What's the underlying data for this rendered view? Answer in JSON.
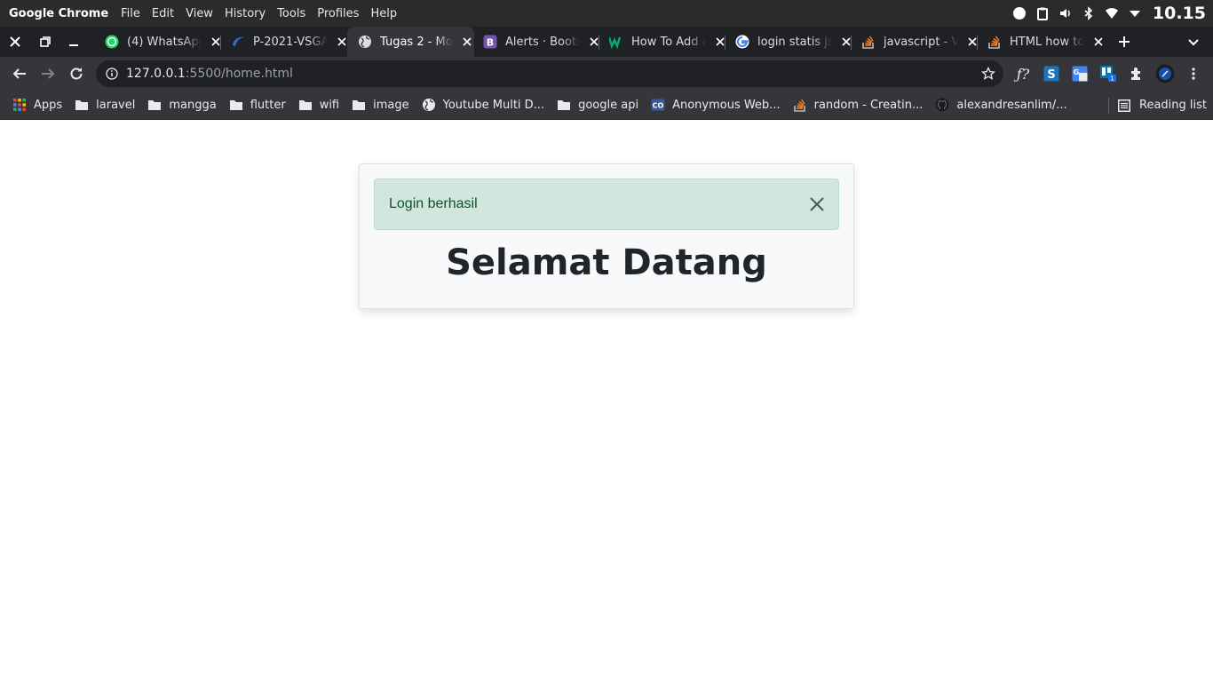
{
  "os_bar": {
    "app_name": "Google Chrome",
    "menus": [
      "File",
      "Edit",
      "View",
      "History",
      "Tools",
      "Profiles",
      "Help"
    ],
    "clock": "10.15"
  },
  "tabs": [
    {
      "title": "(4) WhatsApp",
      "icon": "whatsapp-icon",
      "active": false
    },
    {
      "title": "P-2021-VSGA",
      "icon": "site-icon",
      "active": false
    },
    {
      "title": "Tugas 2 - Mo",
      "icon": "globe-icon",
      "active": true
    },
    {
      "title": "Alerts · Boots",
      "icon": "bootstrap-icon",
      "active": false
    },
    {
      "title": "How To Add a",
      "icon": "w-icon",
      "active": false
    },
    {
      "title": "login statis js",
      "icon": "google-icon",
      "active": false
    },
    {
      "title": "javascript - V",
      "icon": "stackoverflow-icon",
      "active": false
    },
    {
      "title": "HTML how to",
      "icon": "stackoverflow-icon",
      "active": false
    }
  ],
  "omnibox": {
    "host": "127.0.0.1",
    "path": ":5500/home.html"
  },
  "bookmarks": {
    "items": [
      {
        "label": "Apps",
        "icon": "apps-grid-icon"
      },
      {
        "label": "laravel",
        "icon": "folder-icon"
      },
      {
        "label": "mangga",
        "icon": "folder-icon"
      },
      {
        "label": "flutter",
        "icon": "folder-icon"
      },
      {
        "label": "wifi",
        "icon": "folder-icon"
      },
      {
        "label": "image",
        "icon": "folder-icon"
      },
      {
        "label": "Youtube Multi D...",
        "icon": "globe-icon"
      },
      {
        "label": "google api",
        "icon": "folder-icon"
      },
      {
        "label": "Anonymous Web...",
        "icon": "co-icon"
      },
      {
        "label": "random - Creatin...",
        "icon": "stackoverflow-icon"
      },
      {
        "label": "alexandresanlim/...",
        "icon": "github-icon"
      }
    ],
    "reading_list": "Reading list"
  },
  "page": {
    "alert_message": "Login berhasil",
    "heading": "Selamat Datang"
  },
  "colors": {
    "alert_bg": "#d1e7dd",
    "alert_text": "#0f5132",
    "card_bg": "#f8f9fa",
    "chrome_dark": "#202124",
    "chrome_toolbar": "#35363a"
  }
}
